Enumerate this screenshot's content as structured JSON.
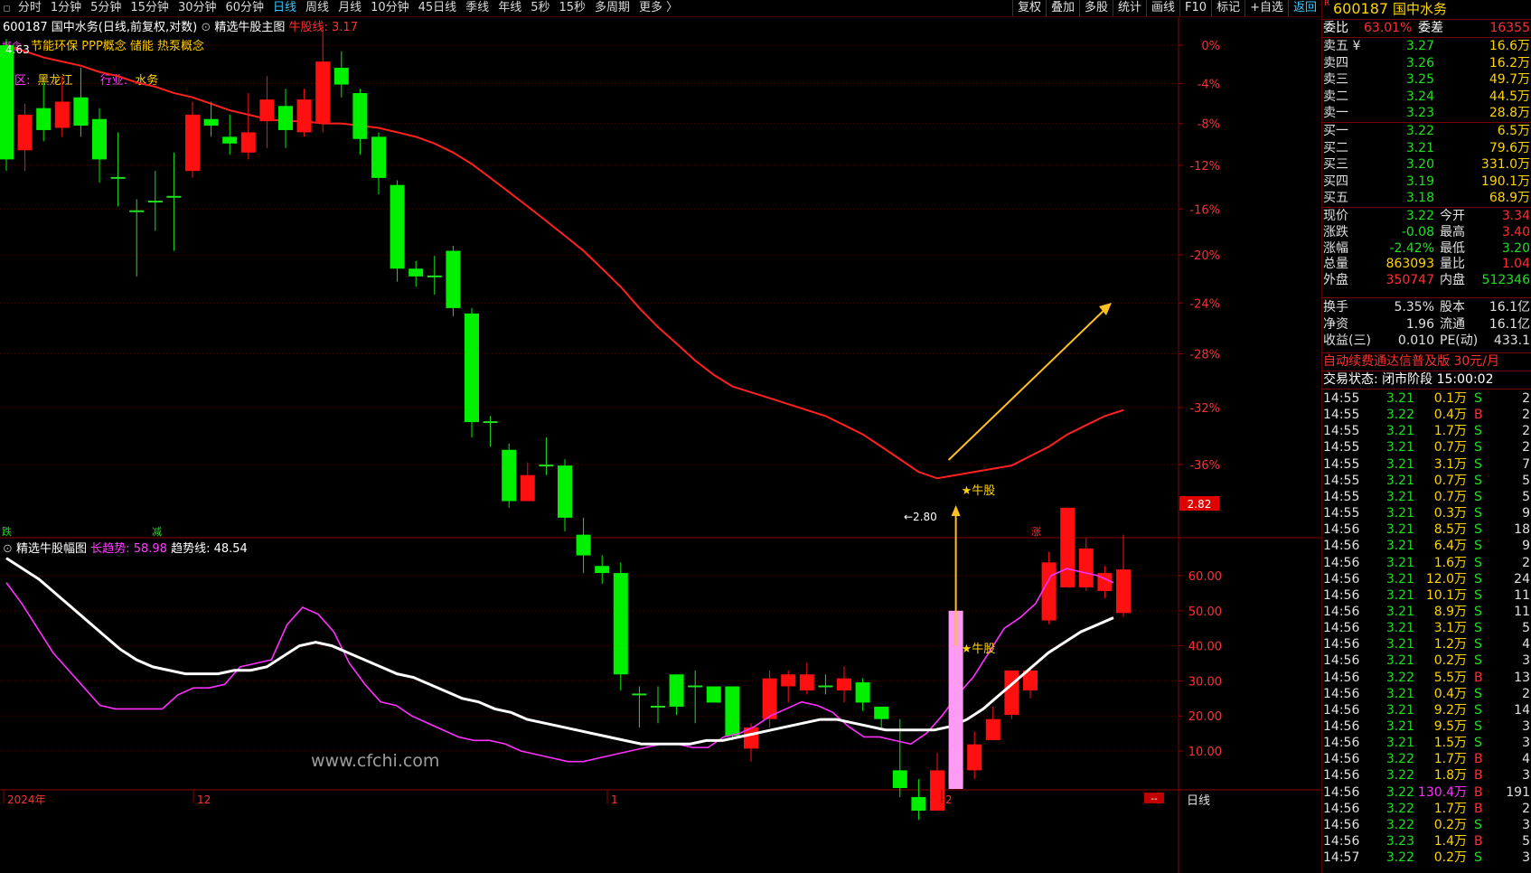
{
  "toolbar": {
    "periods": [
      "分时",
      "1分钟",
      "5分钟",
      "15分钟",
      "30分钟",
      "60分钟",
      "日线",
      "周线",
      "月线",
      "10分钟",
      "45日线",
      "季线",
      "年线",
      "5秒",
      "15秒",
      "多周期",
      "更多 〉"
    ],
    "active_period": "日线",
    "right_buttons": [
      "复权",
      "叠加",
      "多股",
      "统计",
      "画线",
      "F10",
      "标记",
      "+自选",
      "返回"
    ]
  },
  "main_chart": {
    "stock_title": "600187 国中水务(日线,前复权,对数)",
    "indicator_name": "精选牛股主图",
    "indicator_value": "牛股线: 3.17",
    "concepts": "节能环保 PPP概念 储能 热泵概念",
    "concept_tag": "概念",
    "region_label": "区:",
    "region_value": "黑龙江",
    "industry_label": "行业:",
    "industry_value": "水务",
    "high_mark": "4.63",
    "low_mark": "←2.80",
    "signal_label": "★牛股",
    "current_price_tag": "2.82",
    "left_tag_1": "跌",
    "left_tag_2": "减",
    "right_tag": "涨",
    "y_axis_labels": [
      "0%",
      "-4%",
      "-8%",
      "-12%",
      "-16%",
      "-20%",
      "-24%",
      "-28%",
      "-32%",
      "-36%"
    ]
  },
  "sub_chart": {
    "indicator_name": "精选牛股幅图",
    "long_trend_label": "长趋势: 58.98",
    "trend_line_label": "趋势线: 48.54",
    "signal_label": "★牛股",
    "y_axis_labels": [
      "60.00",
      "50.00",
      "40.00",
      "30.00",
      "20.00",
      "10.00"
    ],
    "watermark": "www.cfchi.com"
  },
  "x_axis": {
    "labels": [
      "2024年",
      "12",
      "1",
      "2"
    ],
    "period_label": "日线",
    "corner_tag": "--"
  },
  "chart_data": [
    {
      "type": "candlestick",
      "title": "精选牛股主图",
      "columns": [
        "open",
        "close",
        "high",
        "low"
      ],
      "candles": [
        [
          4.63,
          4.1,
          4.66,
          4.05
        ],
        [
          4.14,
          4.3,
          4.35,
          4.05
        ],
        [
          4.33,
          4.23,
          4.45,
          4.18
        ],
        [
          4.24,
          4.36,
          4.48,
          4.2
        ],
        [
          4.38,
          4.25,
          4.52,
          4.2
        ],
        [
          4.28,
          4.1,
          4.33,
          4.0
        ],
        [
          4.02,
          4.02,
          4.22,
          3.9
        ],
        [
          3.88,
          3.88,
          3.93,
          3.62
        ],
        [
          3.92,
          3.92,
          4.05,
          3.8
        ],
        [
          3.94,
          3.94,
          4.13,
          3.72
        ],
        [
          4.05,
          4.3,
          4.36,
          4.02
        ],
        [
          4.28,
          4.25,
          4.36,
          4.2
        ],
        [
          4.2,
          4.17,
          4.3,
          4.12
        ],
        [
          4.13,
          4.22,
          4.4,
          4.1
        ],
        [
          4.27,
          4.37,
          4.48,
          4.15
        ],
        [
          4.34,
          4.23,
          4.42,
          4.15
        ],
        [
          4.22,
          4.37,
          4.42,
          4.2
        ],
        [
          4.26,
          4.55,
          4.73,
          4.22
        ],
        [
          4.52,
          4.44,
          4.6,
          4.38
        ],
        [
          4.4,
          4.19,
          4.42,
          4.12
        ],
        [
          4.2,
          4.02,
          4.22,
          3.95
        ],
        [
          3.99,
          3.65,
          4.01,
          3.6
        ],
        [
          3.65,
          3.62,
          3.68,
          3.58
        ],
        [
          3.62,
          3.62,
          3.7,
          3.55
        ],
        [
          3.72,
          3.5,
          3.74,
          3.47
        ],
        [
          3.48,
          3.1,
          3.5,
          3.05
        ],
        [
          3.1,
          3.1,
          3.12,
          3.02
        ],
        [
          3.01,
          2.85,
          3.03,
          2.83
        ],
        [
          2.85,
          2.93,
          2.97,
          2.85
        ],
        [
          2.96,
          2.96,
          3.05,
          2.93
        ],
        [
          2.96,
          2.8,
          2.98,
          2.76
        ],
        [
          2.75,
          2.69,
          2.8,
          2.64
        ],
        [
          2.66,
          2.64,
          2.69,
          2.61
        ],
        [
          2.64,
          2.37,
          2.67,
          2.33
        ],
        [
          2.32,
          2.32,
          2.34,
          2.24
        ],
        [
          2.29,
          2.29,
          2.34,
          2.25
        ],
        [
          2.37,
          2.29,
          2.37,
          2.27
        ],
        [
          2.34,
          2.34,
          2.38,
          2.25
        ],
        [
          2.34,
          2.3,
          2.34,
          2.3
        ],
        [
          2.34,
          2.22,
          2.34,
          2.21
        ],
        [
          2.19,
          2.24,
          2.25,
          2.16
        ],
        [
          2.26,
          2.36,
          2.38,
          2.24
        ],
        [
          2.34,
          2.37,
          2.38,
          2.3
        ],
        [
          2.33,
          2.37,
          2.4,
          2.32
        ],
        [
          2.34,
          2.34,
          2.37,
          2.32
        ],
        [
          2.33,
          2.36,
          2.39,
          2.3
        ],
        [
          2.35,
          2.3,
          2.36,
          2.28
        ],
        [
          2.29,
          2.26,
          2.29,
          2.24
        ],
        [
          2.14,
          2.1,
          2.26,
          2.08
        ],
        [
          2.08,
          2.05,
          2.12,
          2.03
        ],
        [
          2.05,
          2.14,
          2.18,
          2.05
        ],
        [
          2.14,
          2.11,
          2.15,
          2.1
        ],
        [
          2.14,
          2.2,
          2.23,
          2.12
        ],
        [
          2.21,
          2.26,
          2.29,
          2.21
        ],
        [
          2.27,
          2.38,
          2.38,
          2.26
        ],
        [
          2.33,
          2.38,
          2.39,
          2.31
        ],
        [
          2.51,
          2.67,
          2.7,
          2.5
        ],
        [
          2.6,
          2.83,
          2.83,
          2.6
        ],
        [
          2.6,
          2.71,
          2.74,
          2.59
        ],
        [
          2.59,
          2.64,
          2.66,
          2.57
        ],
        [
          2.53,
          2.65,
          2.75,
          2.52
        ]
      ],
      "bull_line": [
        4.63,
        4.6,
        4.57,
        4.55,
        4.53,
        4.5,
        4.48,
        4.45,
        4.43,
        4.4,
        4.38,
        4.35,
        4.32,
        4.3,
        4.28,
        4.27,
        4.27,
        4.26,
        4.26,
        4.25,
        4.24,
        4.22,
        4.2,
        4.17,
        4.13,
        4.08,
        4.02,
        3.96,
        3.9,
        3.84,
        3.78,
        3.72,
        3.65,
        3.58,
        3.5,
        3.43,
        3.37,
        3.31,
        3.26,
        3.22,
        3.2,
        3.18,
        3.16,
        3.14,
        3.12,
        3.09,
        3.06,
        3.02,
        2.98,
        2.94,
        2.92,
        2.93,
        2.94,
        2.95,
        2.96,
        2.99,
        3.02,
        3.06,
        3.09,
        3.12,
        3.14
      ],
      "signal_index": 51
    },
    {
      "type": "line",
      "title": "精选牛股幅图",
      "x": [
        1,
        2,
        3,
        4,
        5,
        6,
        7,
        8,
        9,
        10,
        11,
        12,
        13,
        14,
        15,
        16,
        17,
        18,
        19,
        20,
        21,
        22,
        23,
        24,
        25,
        26,
        27,
        28,
        29,
        30,
        31,
        32,
        33,
        34,
        35,
        36,
        37,
        38,
        39,
        40,
        41,
        42,
        43,
        44,
        45,
        46,
        47,
        48,
        49,
        50,
        51,
        52,
        53,
        54,
        55,
        56,
        57,
        58,
        59,
        60,
        61
      ],
      "ylim": [
        0,
        65
      ],
      "series": [
        {
          "name": "长趋势",
          "color": "#ff30ff",
          "values": [
            58,
            52,
            45,
            38,
            33,
            28,
            23,
            22,
            22,
            22,
            22,
            26,
            28,
            28,
            29,
            34,
            35,
            36,
            46,
            51,
            49,
            44,
            35,
            29,
            24,
            23,
            20,
            18,
            16,
            14,
            13,
            13,
            12,
            10,
            9,
            8,
            7,
            7,
            8,
            9,
            10,
            11,
            12,
            12,
            11,
            11,
            14,
            15,
            17,
            20,
            22,
            24,
            23,
            21,
            17,
            14,
            14,
            13,
            12,
            15,
            20,
            26,
            31,
            38,
            45,
            48,
            52,
            60,
            62,
            61,
            60,
            58
          ]
        },
        {
          "name": "趋势线",
          "color": "#ffffff",
          "values": [
            65,
            62,
            59,
            55,
            51,
            47,
            43,
            39,
            36,
            34,
            33,
            32,
            32,
            32,
            33,
            33,
            34,
            37,
            40,
            41,
            40,
            38,
            36,
            34,
            32,
            31,
            29,
            27,
            25,
            24,
            22,
            21,
            19,
            18,
            17,
            16,
            15,
            14,
            13,
            12,
            12,
            12,
            12,
            13,
            13,
            14,
            15,
            16,
            17,
            18,
            19,
            19,
            18,
            17,
            16,
            16,
            16,
            16,
            17,
            19,
            22,
            26,
            30,
            34,
            38,
            41,
            44,
            46,
            48
          ]
        }
      ]
    }
  ],
  "quote_panel": {
    "code": "600187",
    "name": "国中水务",
    "wei_bi_label": "委比",
    "wei_bi": "63.01%",
    "wei_cha_label": "委差",
    "wei_cha": "16355",
    "sell": [
      {
        "label": "卖五 ¥",
        "price": "3.27",
        "vol": "16.6万"
      },
      {
        "label": "卖四",
        "price": "3.26",
        "vol": "16.2万"
      },
      {
        "label": "卖三",
        "price": "3.25",
        "vol": "49.7万"
      },
      {
        "label": "卖二",
        "price": "3.24",
        "vol": "44.5万"
      },
      {
        "label": "卖一",
        "price": "3.23",
        "vol": "28.8万"
      }
    ],
    "buy": [
      {
        "label": "买一",
        "price": "3.22",
        "vol": "6.5万"
      },
      {
        "label": "买二",
        "price": "3.21",
        "vol": "79.6万"
      },
      {
        "label": "买三",
        "price": "3.20",
        "vol": "331.0万"
      },
      {
        "label": "买四",
        "price": "3.19",
        "vol": "190.1万"
      },
      {
        "label": "买五",
        "price": "3.18",
        "vol": "68.9万"
      }
    ],
    "stats": [
      {
        "l1": "现价",
        "v1": "3.22",
        "c1": "#20e020",
        "l2": "今开",
        "v2": "3.34",
        "c2": "#ff3030"
      },
      {
        "l1": "涨跌",
        "v1": "-0.08",
        "c1": "#20e020",
        "l2": "最高",
        "v2": "3.40",
        "c2": "#ff3030"
      },
      {
        "l1": "涨幅",
        "v1": "-2.42%",
        "c1": "#20e020",
        "l2": "最低",
        "v2": "3.20",
        "c2": "#20e020"
      },
      {
        "l1": "总量",
        "v1": "863093",
        "c1": "#ffd400",
        "l2": "量比",
        "v2": "1.04",
        "c2": "#ff3030"
      },
      {
        "l1": "外盘",
        "v1": "350747",
        "c1": "#ff3030",
        "l2": "内盘",
        "v2": "512346",
        "c2": "#20e020"
      }
    ],
    "stats2": [
      {
        "l1": "换手",
        "v1": "5.35%",
        "l2": "股本",
        "v2": "16.1亿"
      },
      {
        "l1": "净资",
        "v1": "1.96",
        "l2": "流通",
        "v2": "16.1亿"
      },
      {
        "l1": "收益(三)",
        "v1": "0.010",
        "l2": "PE(动)",
        "v2": "433.1"
      }
    ],
    "ad_text": "自动续费通达信普及版  30元/月",
    "trade_status": "交易状态: 闭市阶段 15:00:02",
    "ticks": [
      [
        "14:55",
        "3.21",
        "0.1万",
        "S",
        "2"
      ],
      [
        "14:55",
        "3.22",
        "0.4万",
        "B",
        "2"
      ],
      [
        "14:55",
        "3.21",
        "1.7万",
        "S",
        "2"
      ],
      [
        "14:55",
        "3.21",
        "0.7万",
        "S",
        "2"
      ],
      [
        "14:55",
        "3.21",
        "3.1万",
        "S",
        "7"
      ],
      [
        "14:55",
        "3.21",
        "0.7万",
        "S",
        "5"
      ],
      [
        "14:55",
        "3.21",
        "0.7万",
        "S",
        "5"
      ],
      [
        "14:55",
        "3.21",
        "0.3万",
        "S",
        "9"
      ],
      [
        "14:56",
        "3.21",
        "8.5万",
        "S",
        "18"
      ],
      [
        "14:56",
        "3.21",
        "6.4万",
        "S",
        "9"
      ],
      [
        "14:56",
        "3.21",
        "1.6万",
        "S",
        "2"
      ],
      [
        "14:56",
        "3.21",
        "12.0万",
        "S",
        "24"
      ],
      [
        "14:56",
        "3.21",
        "10.1万",
        "S",
        "11"
      ],
      [
        "14:56",
        "3.21",
        "8.9万",
        "S",
        "11"
      ],
      [
        "14:56",
        "3.21",
        "3.1万",
        "S",
        "5"
      ],
      [
        "14:56",
        "3.21",
        "1.2万",
        "S",
        "4"
      ],
      [
        "14:56",
        "3.21",
        "0.2万",
        "S",
        "3"
      ],
      [
        "14:56",
        "3.22",
        "5.5万",
        "B",
        "13"
      ],
      [
        "14:56",
        "3.21",
        "0.4万",
        "S",
        "2"
      ],
      [
        "14:56",
        "3.21",
        "9.2万",
        "S",
        "14"
      ],
      [
        "14:56",
        "3.21",
        "9.5万",
        "S",
        "3"
      ],
      [
        "14:56",
        "3.21",
        "1.5万",
        "S",
        "3"
      ],
      [
        "14:56",
        "3.22",
        "1.7万",
        "B",
        "4"
      ],
      [
        "14:56",
        "3.22",
        "1.8万",
        "B",
        "3"
      ],
      [
        "14:56",
        "3.22",
        "130.4万",
        "B",
        "191"
      ],
      [
        "14:56",
        "3.22",
        "1.7万",
        "B",
        "2"
      ],
      [
        "14:56",
        "3.22",
        "0.2万",
        "S",
        "3"
      ],
      [
        "14:56",
        "3.23",
        "1.4万",
        "B",
        "5"
      ],
      [
        "14:57",
        "3.22",
        "0.2万",
        "S",
        "3"
      ]
    ]
  }
}
